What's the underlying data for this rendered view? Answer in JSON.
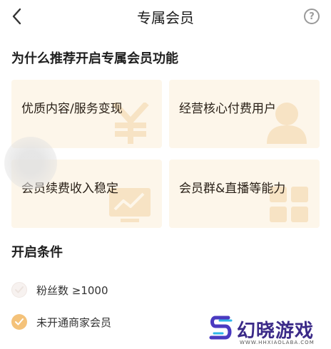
{
  "header": {
    "title": "专属会员",
    "back_icon": "chevron-left-icon",
    "help_icon": "help-circle-icon",
    "help_glyph": "?"
  },
  "why_section": {
    "title": "为什么推荐开启专属会员功能",
    "cards": [
      {
        "label": "优质内容/服务变现",
        "icon": "yuan-icon"
      },
      {
        "label": "经营核心付费用户",
        "icon": "person-icon"
      },
      {
        "label": "会员续费收入稳定",
        "icon": "chart-icon"
      },
      {
        "label": "会员群&直播等能力",
        "icon": "grid-icon"
      }
    ]
  },
  "conditions_section": {
    "title": "开启条件",
    "items": [
      {
        "text": "粉丝数 ≥1000",
        "met": false
      },
      {
        "text": "未开通商家会员",
        "met": true
      }
    ]
  },
  "watermark": {
    "title": "幻晓游戏",
    "url": "WWW.HHXIAOLABA.COM"
  },
  "colors": {
    "card_bg": "#fdf6ea",
    "card_icon": "#f7e3c4",
    "check_met": "#f4c27a",
    "check_unmet": "#f7f2f0"
  }
}
